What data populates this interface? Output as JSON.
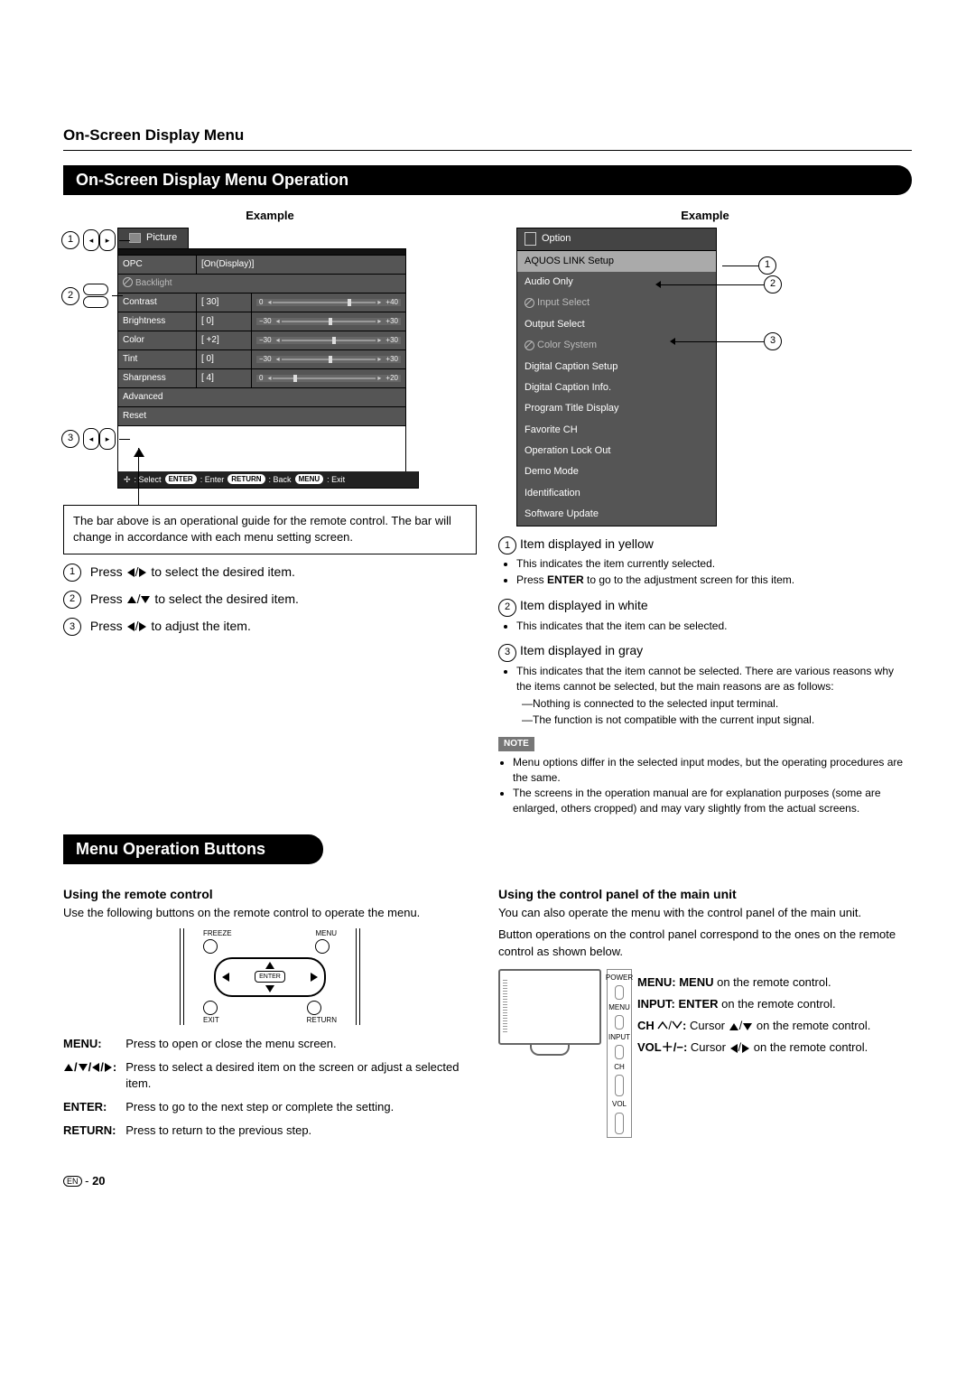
{
  "header": {
    "breadcrumb": "On-Screen Display Menu"
  },
  "bar1": "On-Screen Display Menu Operation",
  "example_label": "Example",
  "picture_menu": {
    "tab": "Picture",
    "opc_label": "OPC",
    "opc_value": "[On(Display)]",
    "backlight": "Backlight",
    "rows": [
      {
        "name": "Contrast",
        "val": "[ 30]",
        "min": "0",
        "max": "+40",
        "pos": 72
      },
      {
        "name": "Brightness",
        "val": "[   0]",
        "min": "−30",
        "max": "+30",
        "pos": 50
      },
      {
        "name": "Color",
        "val": "[ +2]",
        "min": "−30",
        "max": "+30",
        "pos": 54
      },
      {
        "name": "Tint",
        "val": "[   0]",
        "min": "−30",
        "max": "+30",
        "pos": 50
      },
      {
        "name": "Sharpness",
        "val": "[   4]",
        "min": "0",
        "max": "+20",
        "pos": 20
      }
    ],
    "advanced": "Advanced",
    "reset": "Reset",
    "footer": {
      "select": ": Select",
      "enter": ": Enter",
      "back": ": Back",
      "exit": ": Exit",
      "enter_chip": "ENTER",
      "back_chip": "RETURN",
      "exit_chip": "MENU"
    }
  },
  "guide_box": "The bar above is an operational guide for the remote control. The bar will change in accordance with each menu setting screen.",
  "steps": {
    "s1": " to select the desired item.",
    "s1_pre": "Press ",
    "s2": " to select the desired item.",
    "s2_pre": "Press ",
    "s3": " to adjust the item.",
    "s3_pre": "Press "
  },
  "option_menu": {
    "header": "Option",
    "items": [
      {
        "label": "AQUOS LINK Setup",
        "class": "highlight"
      },
      {
        "label": "Audio Only",
        "class": ""
      },
      {
        "label": "Input Select",
        "class": "gray",
        "prohibit": true
      },
      {
        "label": "Output Select",
        "class": ""
      },
      {
        "label": "Color System",
        "class": "gray",
        "prohibit": true
      },
      {
        "label": "Digital Caption Setup",
        "class": ""
      },
      {
        "label": "Digital Caption Info.",
        "class": ""
      },
      {
        "label": "Program Title Display",
        "class": ""
      },
      {
        "label": "Favorite CH",
        "class": ""
      },
      {
        "label": "Operation Lock Out",
        "class": ""
      },
      {
        "label": "Demo Mode",
        "class": ""
      },
      {
        "label": "Identification",
        "class": ""
      },
      {
        "label": "Software Update",
        "class": ""
      }
    ]
  },
  "desc": {
    "h1": "Item displayed in yellow",
    "h1_b1": "This indicates the item currently selected.",
    "h1_b2a": "Press ",
    "h1_b2b": "ENTER",
    "h1_b2c": " to go to the adjustment screen for this item.",
    "h2": "Item displayed in white",
    "h2_b1": "This indicates that the item can be selected.",
    "h3": "Item displayed in gray",
    "h3_b1": "This indicates that the item cannot be selected. There are various reasons why the items cannot be selected, but the main reasons are as follows:",
    "h3_d1": "Nothing is connected to the selected input terminal.",
    "h3_d2": "The function is not compatible with the current input signal."
  },
  "note_label": "NOTE",
  "notes": {
    "n1": "Menu options differ in the selected input modes, but the operating procedures are the same.",
    "n2": "The screens in the operation manual are for explanation purposes (some are enlarged, others cropped) and may vary slightly from the actual screens."
  },
  "bar2": "Menu Operation Buttons",
  "remote": {
    "head": "Using the remote control",
    "para": "Use the following buttons on the remote control to operate the menu.",
    "labels": {
      "freeze": "FREEZE",
      "menu": "MENU",
      "enter": "ENTER",
      "exit": "EXIT",
      "return": "RETURN"
    },
    "table": {
      "menu": {
        "k": "MENU:",
        "v": "Press to open or close the menu screen."
      },
      "arrows_v": "Press to select a desired item on the screen or adjust a selected item.",
      "enter": {
        "k": "ENTER:",
        "v": "Press to go to the next step or complete the setting."
      },
      "return": {
        "k": "RETURN:",
        "v": "Press to return to the previous step."
      }
    }
  },
  "panel": {
    "head": "Using the control panel of the main unit",
    "p1": "You can also operate the menu with the control panel of the main unit.",
    "p2": "Button operations on the control panel correspond to the ones on the remote control as shown below.",
    "labels": {
      "power": "POWER",
      "menu": "MENU",
      "input": "INPUT",
      "ch": "CH",
      "vol": "VOL"
    },
    "desc": {
      "menu_a": "MENU: MENU",
      "menu_b": " on the remote control.",
      "input_a": "INPUT: ENTER",
      "input_b": " on the remote control.",
      "ch_a": "CH",
      "ch_b": " Cursor ",
      "ch_c": " on the remote control.",
      "vol_a": "VOL",
      "vol_b": " Cursor ",
      "vol_c": " on the remote control."
    }
  },
  "page": {
    "lang": "EN",
    "num": "20"
  }
}
